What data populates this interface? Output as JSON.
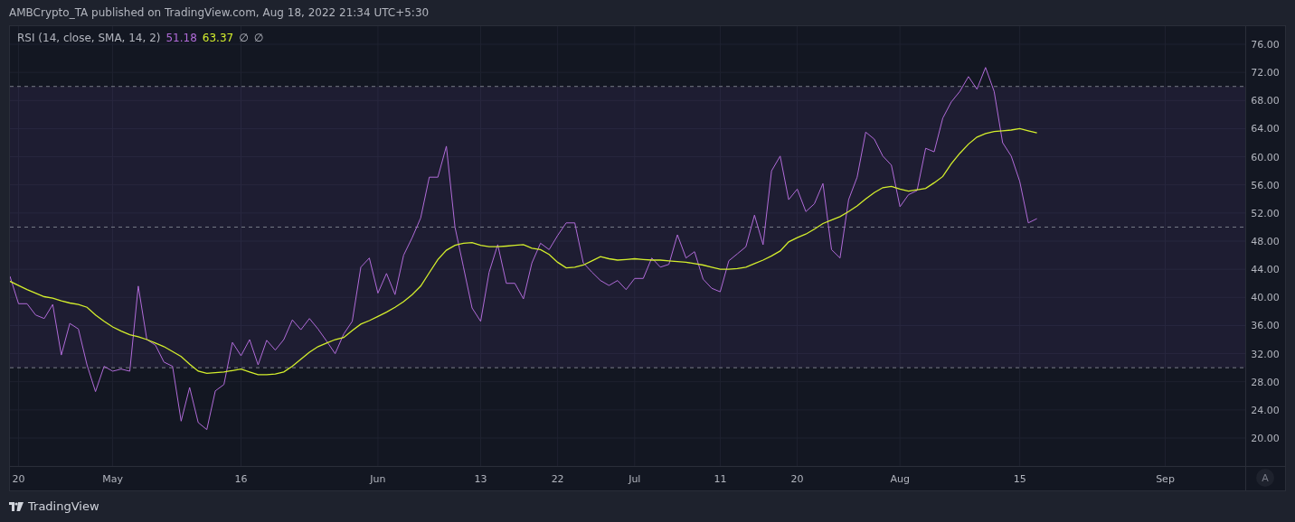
{
  "header": {
    "text": "AMBCrypto_TA published on TradingView.com, Aug 18, 2022 21:34 UTC+5:30"
  },
  "legend": {
    "title": "RSI (14, close, SMA, 14, 2)",
    "values": [
      "51.18",
      "63.37"
    ],
    "extras": [
      "∅",
      "∅"
    ]
  },
  "chart": {
    "chart_data": {
      "type": "line",
      "x": [
        "2022-04-19",
        "2022-04-20",
        "2022-04-21",
        "2022-04-22",
        "2022-04-23",
        "2022-04-24",
        "2022-04-25",
        "2022-04-26",
        "2022-04-27",
        "2022-04-28",
        "2022-04-29",
        "2022-04-30",
        "2022-05-01",
        "2022-05-02",
        "2022-05-03",
        "2022-05-04",
        "2022-05-05",
        "2022-05-06",
        "2022-05-07",
        "2022-05-08",
        "2022-05-09",
        "2022-05-10",
        "2022-05-11",
        "2022-05-12",
        "2022-05-13",
        "2022-05-14",
        "2022-05-15",
        "2022-05-16",
        "2022-05-17",
        "2022-05-18",
        "2022-05-19",
        "2022-05-20",
        "2022-05-21",
        "2022-05-22",
        "2022-05-23",
        "2022-05-24",
        "2022-05-25",
        "2022-05-26",
        "2022-05-27",
        "2022-05-28",
        "2022-05-29",
        "2022-05-30",
        "2022-05-31",
        "2022-06-01",
        "2022-06-02",
        "2022-06-03",
        "2022-06-04",
        "2022-06-05",
        "2022-06-06",
        "2022-06-07",
        "2022-06-08",
        "2022-06-09",
        "2022-06-10",
        "2022-06-11",
        "2022-06-12",
        "2022-06-13",
        "2022-06-14",
        "2022-06-15",
        "2022-06-16",
        "2022-06-17",
        "2022-06-18",
        "2022-06-19",
        "2022-06-20",
        "2022-06-21",
        "2022-06-22",
        "2022-06-23",
        "2022-06-24",
        "2022-06-25",
        "2022-06-26",
        "2022-06-27",
        "2022-06-28",
        "2022-06-29",
        "2022-06-30",
        "2022-07-01",
        "2022-07-02",
        "2022-07-03",
        "2022-07-04",
        "2022-07-05",
        "2022-07-06",
        "2022-07-07",
        "2022-07-08",
        "2022-07-09",
        "2022-07-10",
        "2022-07-11",
        "2022-07-12",
        "2022-07-13",
        "2022-07-14",
        "2022-07-15",
        "2022-07-16",
        "2022-07-17",
        "2022-07-18",
        "2022-07-19",
        "2022-07-20",
        "2022-07-21",
        "2022-07-22",
        "2022-07-23",
        "2022-07-24",
        "2022-07-25",
        "2022-07-26",
        "2022-07-27",
        "2022-07-28",
        "2022-07-29",
        "2022-07-30",
        "2022-07-31",
        "2022-08-01",
        "2022-08-02",
        "2022-08-03",
        "2022-08-04",
        "2022-08-05",
        "2022-08-06",
        "2022-08-07",
        "2022-08-08",
        "2022-08-09",
        "2022-08-10",
        "2022-08-11",
        "2022-08-12",
        "2022-08-13",
        "2022-08-14",
        "2022-08-15",
        "2022-08-16",
        "2022-08-17"
      ],
      "series": [
        {
          "color": "#b06bd8",
          "values": [
            43,
            39.1,
            39.1,
            37.5,
            37,
            39,
            31.8,
            36.3,
            35.5,
            30.4,
            26.6,
            30.2,
            29.5,
            29.8,
            29.5,
            41.6,
            34,
            33.2,
            30.8,
            30.2,
            22.4,
            27.2,
            22.2,
            21.2,
            26.7,
            27.6,
            33.6,
            31.7,
            34,
            30.4,
            33.9,
            32.5,
            34,
            36.8,
            35.4,
            37,
            35.5,
            33.8,
            32,
            34.8,
            36.6,
            44.3,
            45.6,
            40.6,
            43.4,
            40.4,
            46,
            48.5,
            51.3,
            57.1,
            57.1,
            61.5,
            50,
            44.3,
            38.5,
            36.6,
            43.6,
            47.5,
            42,
            42,
            39.8,
            44.9,
            47.7,
            46.8,
            48.8,
            50.6,
            50.6,
            44.9,
            43.6,
            42.4,
            41.7,
            42.4,
            41.1,
            42.7,
            42.7,
            45.6,
            44.3,
            44.7,
            48.9,
            45.6,
            46.5,
            42.6,
            41.3,
            40.8,
            45.2,
            46.2,
            47.2,
            51.7,
            47.5,
            58,
            60.1,
            53.9,
            55.4,
            52.2,
            53.3,
            56.2,
            46.8,
            45.6,
            53.9,
            57.1,
            63.5,
            62.5,
            60.1,
            58.8,
            52.9,
            54.6,
            55.2,
            61.2,
            60.7,
            65.5,
            67.8,
            69.3,
            71.4,
            69.6,
            72.7,
            69.3,
            62,
            60.1,
            56.5,
            50.6,
            51.2
          ]
        },
        {
          "color": "#d4ee2c",
          "values": [
            42.3,
            41.7,
            41.1,
            40.6,
            40.1,
            39.9,
            39.5,
            39.2,
            39,
            38.6,
            37.5,
            36.6,
            35.8,
            35.2,
            34.7,
            34.4,
            34,
            33.5,
            33,
            32.3,
            31.6,
            30.5,
            29.5,
            29.2,
            29.3,
            29.4,
            29.6,
            29.8,
            29.4,
            29,
            29,
            29.1,
            29.4,
            30.2,
            31.2,
            32.2,
            33,
            33.5,
            34,
            34.3,
            35.3,
            36.2,
            36.7,
            37.3,
            37.9,
            38.6,
            39.4,
            40.4,
            41.6,
            43.5,
            45.4,
            46.7,
            47.4,
            47.7,
            47.8,
            47.4,
            47.2,
            47.2,
            47.3,
            47.4,
            47.5,
            47,
            46.8,
            46.1,
            45,
            44.2,
            44.3,
            44.6,
            45.2,
            45.8,
            45.5,
            45.3,
            45.4,
            45.5,
            45.4,
            45.3,
            45.3,
            45.2,
            45.1,
            45,
            44.8,
            44.6,
            44.3,
            44,
            44,
            44.1,
            44.3,
            44.8,
            45.3,
            45.9,
            46.6,
            47.9,
            48.5,
            49,
            49.7,
            50.5,
            51,
            51.5,
            52.2,
            53,
            54,
            54.9,
            55.6,
            55.8,
            55.4,
            55.1,
            55.3,
            55.5,
            56.3,
            57.2,
            59,
            60.5,
            61.8,
            62.8,
            63.3,
            63.6,
            63.7,
            63.8,
            64,
            63.7,
            63.4
          ]
        }
      ],
      "xlim": [
        "2022-04-19",
        "2022-09-15"
      ],
      "ylim": [
        16.02,
        78.57
      ],
      "xticks": [
        {
          "value": "2022-04-20",
          "label": "20"
        },
        {
          "value": "2022-05-01",
          "label": "May"
        },
        {
          "value": "2022-05-16",
          "label": "16"
        },
        {
          "value": "2022-06-01",
          "label": "Jun"
        },
        {
          "value": "2022-06-13",
          "label": "13"
        },
        {
          "value": "2022-06-22",
          "label": "22"
        },
        {
          "value": "2022-07-01",
          "label": "Jul"
        },
        {
          "value": "2022-07-11",
          "label": "11"
        },
        {
          "value": "2022-07-20",
          "label": "20"
        },
        {
          "value": "2022-08-01",
          "label": "Aug"
        },
        {
          "value": "2022-08-15",
          "label": "15"
        },
        {
          "value": "2022-09-01",
          "label": "Sep"
        }
      ],
      "yticks": [
        {
          "value": 76,
          "label": "76.00"
        },
        {
          "value": 72,
          "label": "72.00"
        },
        {
          "value": 68,
          "label": "68.00"
        },
        {
          "value": 64,
          "label": "64.00"
        },
        {
          "value": 60,
          "label": "60.00"
        },
        {
          "value": 56,
          "label": "56.00"
        },
        {
          "value": 52,
          "label": "52.00"
        },
        {
          "value": 48,
          "label": "48.00"
        },
        {
          "value": 44,
          "label": "44.00"
        },
        {
          "value": 40,
          "label": "40.00"
        },
        {
          "value": 36,
          "label": "36.00"
        },
        {
          "value": 32,
          "label": "32.00"
        },
        {
          "value": 28,
          "label": "28.00"
        },
        {
          "value": 24,
          "label": "24.00"
        },
        {
          "value": 20,
          "label": "20.00"
        }
      ],
      "grid": true,
      "bands": [
        {
          "axis": "y",
          "from": 30,
          "to": 70,
          "color": "#7e57c2"
        }
      ],
      "ref_lines": [
        {
          "axis": "y",
          "value": 70
        },
        {
          "axis": "y",
          "value": 50
        },
        {
          "axis": "y",
          "value": 30
        }
      ]
    },
    "scale_button": "A"
  },
  "footer": {
    "brand": "TradingView"
  }
}
